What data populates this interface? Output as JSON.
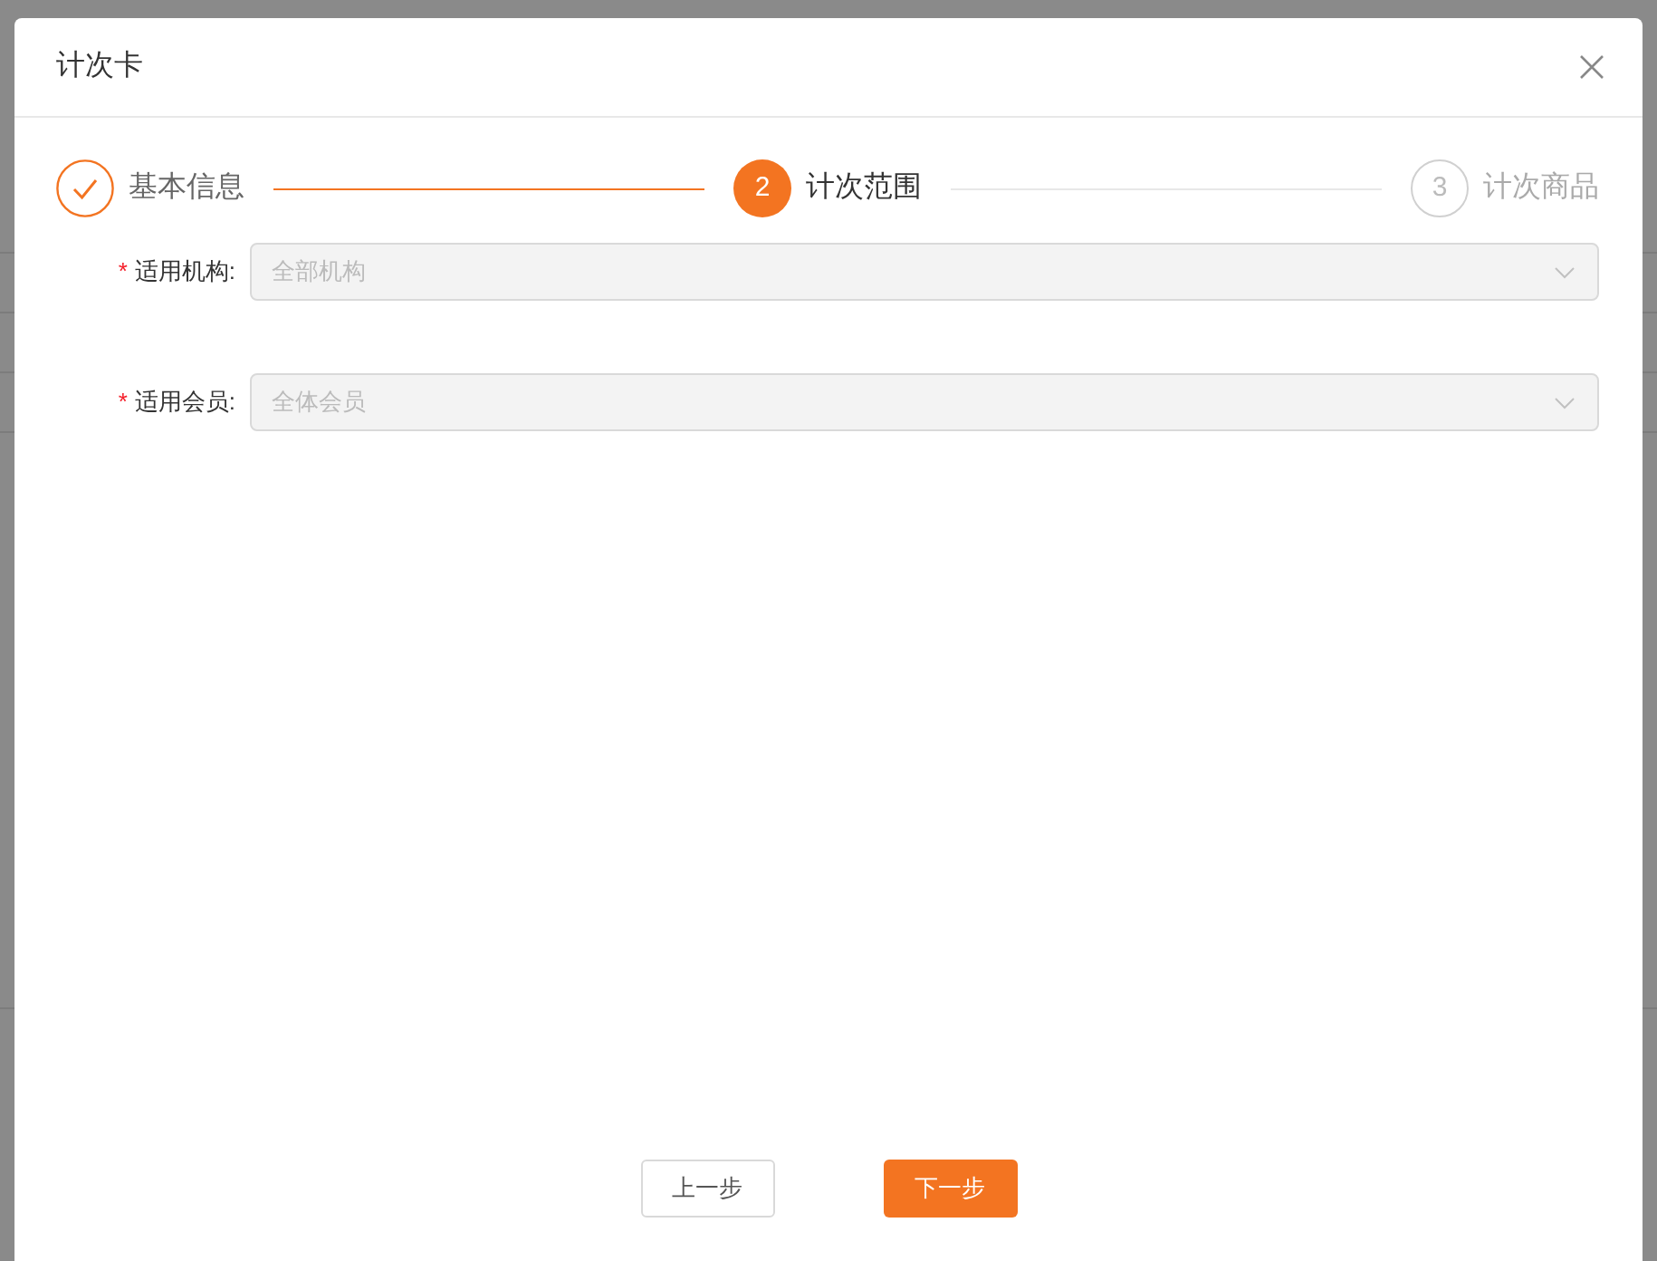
{
  "dialog": {
    "title": "计次卡"
  },
  "steps": [
    {
      "label": "基本信息",
      "done": true,
      "selected": false
    },
    {
      "number": "2",
      "label": "计次范围",
      "done": false,
      "selected": true
    },
    {
      "number": "3",
      "label": "计次商品",
      "done": false,
      "selected": false
    }
  ],
  "fields": [
    {
      "required_mark": "*",
      "label": "适用机构:",
      "placeholder": "全部机构",
      "disabled": true
    },
    {
      "required_mark": "*",
      "label": "适用会员:",
      "placeholder": "全体会员",
      "disabled": true
    }
  ],
  "buttons": [
    {
      "label": "上一步",
      "kind": "default"
    },
    {
      "label": "下一步",
      "kind": "primary"
    }
  ]
}
